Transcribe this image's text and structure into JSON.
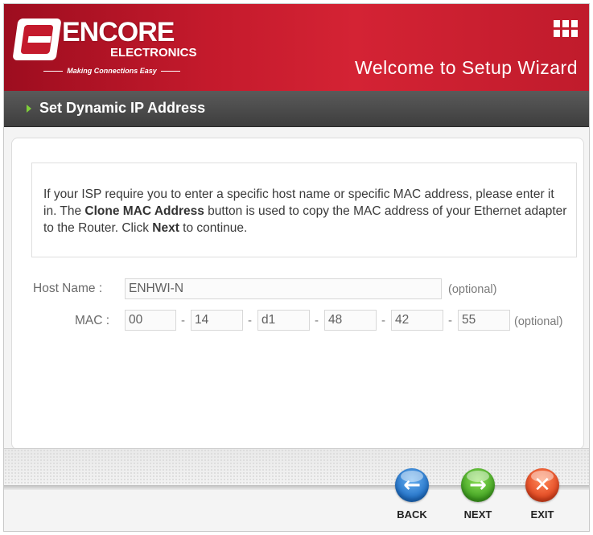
{
  "header": {
    "logo_text": "ENCORE",
    "logo_sub": "ELECTRONICS",
    "tagline": "Making Connections Easy",
    "welcome": "Welcome to Setup Wizard"
  },
  "section": {
    "title": "Set Dynamic IP Address"
  },
  "info": {
    "text_1": "If your ISP require you to enter a specific host name or specific MAC address, please enter it in. The ",
    "bold_1": "Clone MAC Address",
    "text_2": " button is used to copy the MAC address of your Ethernet adapter to the Router. Click ",
    "bold_2": "Next",
    "text_3": " to continue."
  },
  "form": {
    "host_label": "Host Name :",
    "host_value": "ENHWI-N",
    "host_optional": "(optional)",
    "mac_label": "MAC :",
    "mac_values": [
      "00",
      "14",
      "d1",
      "48",
      "42",
      "55"
    ],
    "mac_separator": "-",
    "mac_optional": "(optional)"
  },
  "buttons": {
    "back": "BACK",
    "next": "NEXT",
    "exit": "EXIT"
  },
  "icons": {
    "grid": "grid-icon",
    "section_arrow": "arrow-right-icon",
    "back": "arrow-left-circle-icon",
    "next": "arrow-right-circle-icon",
    "exit": "close-circle-icon"
  },
  "colors": {
    "header_red": "#c41a2c",
    "section_bar": "#4a4a4a",
    "accent_green": "#7fcf3a"
  }
}
